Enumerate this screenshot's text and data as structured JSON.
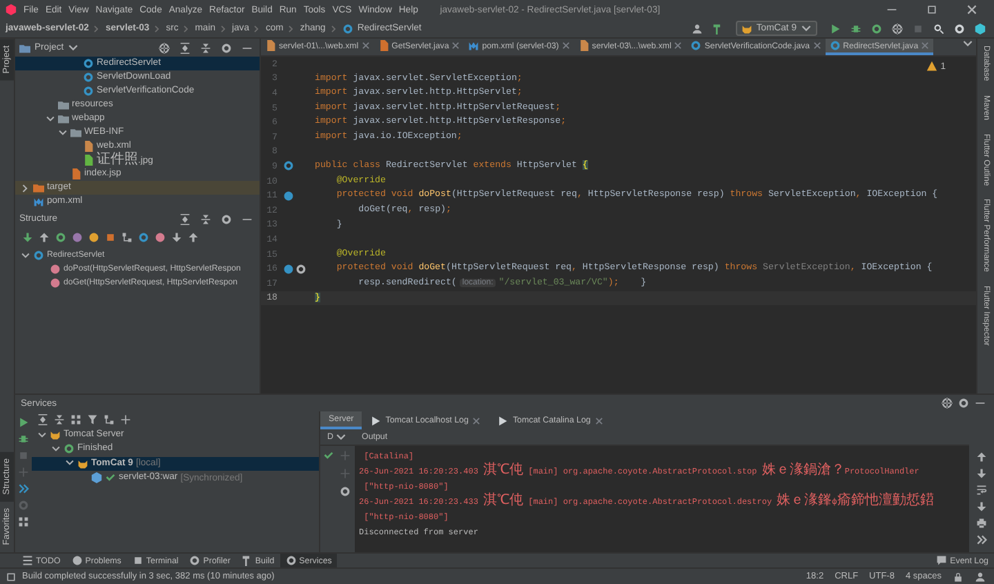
{
  "menu": [
    "File",
    "Edit",
    "View",
    "Navigate",
    "Code",
    "Analyze",
    "Refactor",
    "Build",
    "Run",
    "Tools",
    "VCS",
    "Window",
    "Help"
  ],
  "window_title": "javaweb-servlet-02 - RedirectServlet.java [servlet-03]",
  "breadcrumbs": [
    {
      "label": "javaweb-servlet-02",
      "kind": "module"
    },
    {
      "label": "servlet-03",
      "kind": "module"
    },
    {
      "label": "src",
      "kind": "folder"
    },
    {
      "label": "main",
      "kind": "folder"
    },
    {
      "label": "java",
      "kind": "folder"
    },
    {
      "label": "com",
      "kind": "folder"
    },
    {
      "label": "zhang",
      "kind": "folder"
    },
    {
      "label": "RedirectServlet",
      "kind": "class"
    }
  ],
  "run_config": "TomCat 9",
  "left_strip": {
    "top": [
      {
        "label": "Project",
        "selected": true
      }
    ],
    "bottom": [
      {
        "label": "Structure",
        "selected": true
      },
      {
        "label": "Favorites",
        "selected": false
      }
    ]
  },
  "project_panel": {
    "title": "Project",
    "tree": [
      {
        "children": [
          {
            "children": [
              {
                "children": [
                  {
                    "children": [
                      {
                        "label": "RedirectServlet",
                        "kind": "class",
                        "selected": true,
                        "hovered": false
                      },
                      {
                        "label": "ServletDownLoad",
                        "kind": "class",
                        "selected": false,
                        "hovered": false
                      },
                      {
                        "label": "ServletVerificationCode",
                        "kind": "class",
                        "selected": false,
                        "hovered": false
                      }
                    ]
                  }
                ]
              },
              {
                "label": "resources",
                "kind": "folder",
                "selected": false,
                "hovered": false
              },
              {
                "label": "webapp",
                "kind": "folder",
                "expanded": true,
                "selected": false,
                "hovered": false,
                "children": [
                  {
                    "label": "WEB-INF",
                    "kind": "folder",
                    "expanded": true,
                    "selected": false,
                    "hovered": false,
                    "children": [
                      {
                        "label": "web.xml",
                        "kind": "xml",
                        "selected": false,
                        "hovered": false
                      },
                      {
                        "label": "证件照.jpg",
                        "kind": "image",
                        "selected": false,
                        "hovered": false
                      }
                    ]
                  },
                  {
                    "label": "index.jsp",
                    "kind": "jsp",
                    "selected": false,
                    "hovered": false
                  }
                ]
              }
            ]
          }
        ]
      },
      {
        "label": "target",
        "kind": "folder-excluded",
        "expanded": false,
        "selected": false,
        "hovered": true
      },
      {
        "label": "pom.xml",
        "kind": "maven",
        "selected": false,
        "hovered": false
      }
    ]
  },
  "structure_panel": {
    "title": "Structure",
    "tree": [
      {
        "label": "RedirectServlet",
        "kind": "class",
        "expanded": true,
        "selected": false,
        "children": [
          {
            "label": "doPost(HttpServletRequest, HttpServletRespon",
            "kind": "method",
            "selected": false
          },
          {
            "label": "doGet(HttpServletRequest, HttpServletRespon",
            "kind": "method",
            "selected": false
          }
        ]
      }
    ]
  },
  "editor": {
    "tabs": [
      {
        "label": "servlet-01\\...\\web.xml",
        "kind": "xml",
        "selected": false
      },
      {
        "label": "GetServlet.java",
        "kind": "java",
        "selected": false
      },
      {
        "label": "pom.xml (servlet-03)",
        "kind": "maven",
        "selected": false
      },
      {
        "label": "servlet-03\\...\\web.xml",
        "kind": "xml",
        "selected": false
      },
      {
        "label": "ServletVerificationCode.java",
        "kind": "class",
        "selected": false
      },
      {
        "label": "RedirectServlet.java",
        "kind": "class",
        "selected": true
      }
    ],
    "warnings": "1",
    "lines": [
      {
        "number": "2",
        "current": false
      },
      {
        "number": "3",
        "current": false,
        "tokens": [
          {
            "text": "import ",
            "kind": "kw"
          },
          {
            "text": "javax.servlet.ServletException",
            "kind": "id"
          },
          {
            "text": ";",
            "kind": "kw"
          }
        ]
      },
      {
        "number": "4",
        "current": false,
        "tokens": [
          {
            "text": "import ",
            "kind": "kw"
          },
          {
            "text": "javax.servlet.http.HttpServlet",
            "kind": "id"
          },
          {
            "text": ";",
            "kind": "kw"
          }
        ]
      },
      {
        "number": "5",
        "current": false,
        "tokens": [
          {
            "text": "import ",
            "kind": "kw"
          },
          {
            "text": "javax.servlet.http.HttpServletRequest",
            "kind": "id"
          },
          {
            "text": ";",
            "kind": "kw"
          }
        ]
      },
      {
        "number": "6",
        "current": false,
        "tokens": [
          {
            "text": "import ",
            "kind": "kw"
          },
          {
            "text": "javax.servlet.http.HttpServletResponse",
            "kind": "id"
          },
          {
            "text": ";",
            "kind": "kw"
          }
        ]
      },
      {
        "number": "7",
        "current": false,
        "tokens": [
          {
            "text": "import ",
            "kind": "kw"
          },
          {
            "text": "java.io.IOException",
            "kind": "id"
          },
          {
            "text": ";",
            "kind": "kw"
          }
        ]
      },
      {
        "number": "8",
        "current": false
      },
      {
        "number": "9",
        "current": false,
        "kind": "servlet",
        "tokens": [
          {
            "text": "public class ",
            "kind": "kw"
          },
          {
            "text": "RedirectServlet ",
            "kind": "id"
          },
          {
            "text": "extends ",
            "kind": "kw"
          },
          {
            "text": "HttpServlet ",
            "kind": "id"
          },
          {
            "text": "{",
            "kind": "brace"
          }
        ]
      },
      {
        "number": "10",
        "current": false,
        "tokens": [
          {
            "text": "    @Override",
            "kind": "ann"
          }
        ]
      },
      {
        "number": "11",
        "current": false,
        "kind": "override",
        "tokens": [
          {
            "text": "    protected void ",
            "kind": "kw"
          },
          {
            "text": "doPost",
            "kind": "fn"
          },
          {
            "text": "(HttpServletRequest req",
            "kind": "id"
          },
          {
            "text": ", ",
            "kind": "kw"
          },
          {
            "text": "HttpServletResponse resp) ",
            "kind": "id"
          },
          {
            "text": "throws ",
            "kind": "kw"
          },
          {
            "text": "ServletException",
            "kind": "id"
          },
          {
            "text": ", ",
            "kind": "kw"
          },
          {
            "text": "IOException {",
            "kind": "id"
          }
        ]
      },
      {
        "number": "12",
        "current": false,
        "tokens": [
          {
            "text": "        doGet(req",
            "kind": "id"
          },
          {
            "text": ", ",
            "kind": "kw"
          },
          {
            "text": "resp)",
            "kind": "id"
          },
          {
            "text": ";",
            "kind": "kw"
          }
        ]
      },
      {
        "number": "13",
        "current": false,
        "tokens": [
          {
            "text": "    }",
            "kind": "id"
          }
        ]
      },
      {
        "number": "14",
        "current": false
      },
      {
        "number": "15",
        "current": false,
        "tokens": [
          {
            "text": "    @Override",
            "kind": "ann"
          }
        ]
      },
      {
        "number": "16",
        "current": false,
        "kind": "override-mapping",
        "tokens": [
          {
            "text": "    protected void ",
            "kind": "kw"
          },
          {
            "text": "doGet",
            "kind": "fn"
          },
          {
            "text": "(HttpServletRequest req",
            "kind": "id"
          },
          {
            "text": ", ",
            "kind": "kw"
          },
          {
            "text": "HttpServletResponse resp) ",
            "kind": "id"
          },
          {
            "text": "throws ",
            "kind": "kw"
          },
          {
            "text": "ServletException",
            "kind": "dim"
          },
          {
            "text": ", ",
            "kind": "kw"
          },
          {
            "text": "IOException {",
            "kind": "id"
          }
        ]
      },
      {
        "number": "17",
        "current": false,
        "tokens": [
          {
            "text": "        resp.sendRedirect(",
            "kind": "id"
          },
          {
            "text": "location:",
            "kind": "hint"
          },
          {
            "text": "\"/servlet_03_war/VC\"",
            "kind": "str"
          },
          {
            "text": ");",
            "kind": "kw"
          },
          {
            "text": "    }",
            "kind": "id"
          }
        ]
      },
      {
        "number": "18",
        "current": true,
        "tokens": [
          {
            "text": "}",
            "kind": "brace"
          }
        ]
      }
    ]
  },
  "right_strip": [
    "Database",
    "Maven",
    "Flutter Outline",
    "Flutter Performance",
    "Flutter Inspector"
  ],
  "services": {
    "title": "Services",
    "tree": [
      {
        "label": "Tomcat Server",
        "kind": "server",
        "expanded": true,
        "selected": false,
        "children": [
          {
            "label": "Finished",
            "kind": "status",
            "expanded": true,
            "selected": false,
            "children": [
              {
                "label": "TomCat 9",
                "note": "[local]",
                "kind": "tomcat",
                "expanded": true,
                "selected": true,
                "children": [
                  {
                    "label": "servlet-03:war",
                    "note": "[Synchronized]",
                    "kind": "artifact",
                    "selected": false
                  }
                ]
              }
            ]
          }
        ]
      }
    ],
    "tabs": [
      {
        "label": "Server",
        "kind": "plain",
        "selected": true
      },
      {
        "label": "Tomcat Localhost Log",
        "kind": "log",
        "selected": false
      },
      {
        "label": "Tomcat Catalina Log",
        "kind": "log",
        "selected": false
      }
    ],
    "column_1": "D",
    "output_label": "Output",
    "log": [
      {
        "text": " [Catalina]",
        "kind": "error"
      },
      {
        "text": "26-Jun-2021 16:20:23.403 淇℃伅 [main] org.apache.coyote.AbstractProtocol.stop 姝ｅ湪鍋滄？ProtocolHandler",
        "kind": "error"
      },
      {
        "text": " [\"http-nio-8080\"]",
        "kind": "error"
      },
      {
        "text": "26-Jun-2021 16:20:23.433 淇℃伅 [main] org.apache.coyote.AbstractProtocol.destroy 姝ｅ湪鎽ф瘉鍗忚澶勭悊鍣",
        "kind": "error"
      },
      {
        "text": " [\"http-nio-8080\"]",
        "kind": "error"
      },
      {
        "text": "Disconnected from server",
        "kind": "normal"
      }
    ]
  },
  "tool_windows": [
    {
      "label": "TODO",
      "selected": false
    },
    {
      "label": "Problems",
      "selected": false
    },
    {
      "label": "Terminal",
      "selected": false
    },
    {
      "label": "Profiler",
      "selected": false
    },
    {
      "label": "Build",
      "selected": false
    },
    {
      "label": "Services",
      "selected": true
    }
  ],
  "event_log": "Event Log",
  "status_bar": {
    "message": "Build completed successfully in 3 sec, 382 ms (10 minutes ago)",
    "position": "18:2",
    "line_separator": "CRLF",
    "encoding": "UTF-8",
    "indent": "4 spaces"
  }
}
